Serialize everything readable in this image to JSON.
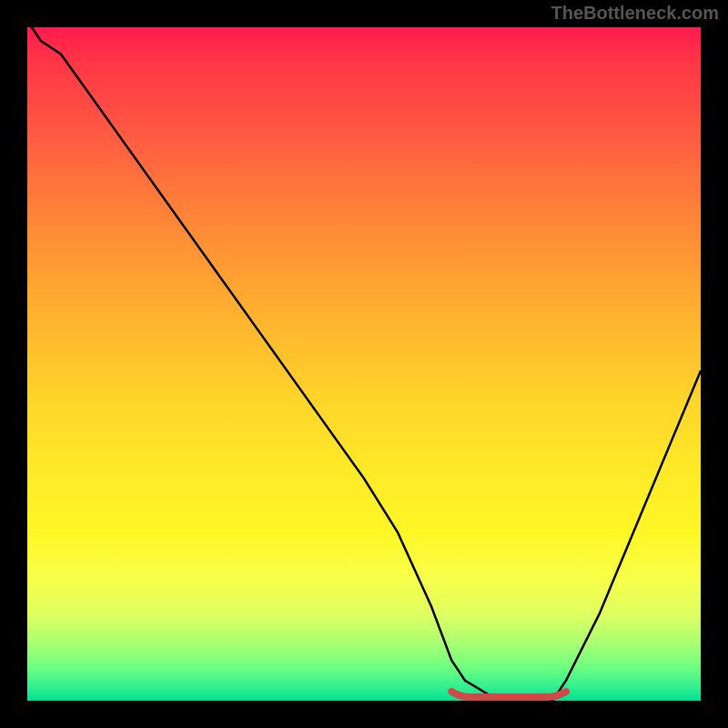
{
  "watermark": "TheBottleneck.com",
  "colors": {
    "background": "#000000",
    "gradient_top": "#ff1a4d",
    "gradient_bottom": "#00e090",
    "curve": "#000000",
    "marker": "#d04848"
  },
  "chart_data": {
    "type": "line",
    "title": "",
    "xlabel": "",
    "ylabel": "",
    "xlim": [
      0,
      100
    ],
    "ylim": [
      0,
      100
    ],
    "x": [
      0,
      2,
      5,
      10,
      20,
      30,
      40,
      50,
      55,
      60,
      63,
      65,
      70,
      75,
      78,
      80,
      85,
      90,
      95,
      100
    ],
    "values": [
      101,
      98,
      96,
      89,
      75,
      61,
      47,
      33,
      25,
      14,
      6,
      3,
      0,
      0,
      0,
      3,
      13,
      25,
      37,
      49
    ],
    "minimum_region": {
      "x_start": 63,
      "x_end": 80,
      "y": 0
    },
    "annotations": []
  }
}
